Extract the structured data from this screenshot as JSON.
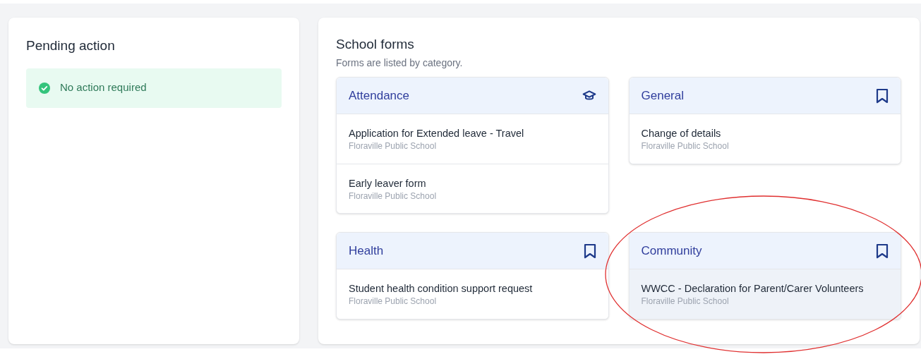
{
  "pending": {
    "title": "Pending action",
    "status": {
      "text": "No action required"
    }
  },
  "forms": {
    "title": "School forms",
    "subtitle": "Forms are listed by category.",
    "categories": [
      {
        "name": "Attendance",
        "kind": "graduation",
        "circled": false,
        "items": [
          {
            "title": "Application for Extended leave - Travel",
            "school": "Floraville Public School",
            "highlighted": false
          },
          {
            "title": "Early leaver form",
            "school": "Floraville Public School",
            "highlighted": false
          }
        ]
      },
      {
        "name": "General",
        "kind": "bookmark",
        "circled": false,
        "items": [
          {
            "title": "Change of details",
            "school": "Floraville Public School",
            "highlighted": false
          }
        ]
      },
      {
        "name": "Health",
        "kind": "bookmark",
        "circled": false,
        "items": [
          {
            "title": "Student health condition support request",
            "school": "Floraville Public School",
            "highlighted": false
          }
        ]
      },
      {
        "name": "Community",
        "kind": "bookmark",
        "circled": true,
        "items": [
          {
            "title": "WWCC - Declaration for Parent/Carer Volunteers",
            "school": "Floraville Public School",
            "highlighted": true
          }
        ]
      }
    ]
  }
}
